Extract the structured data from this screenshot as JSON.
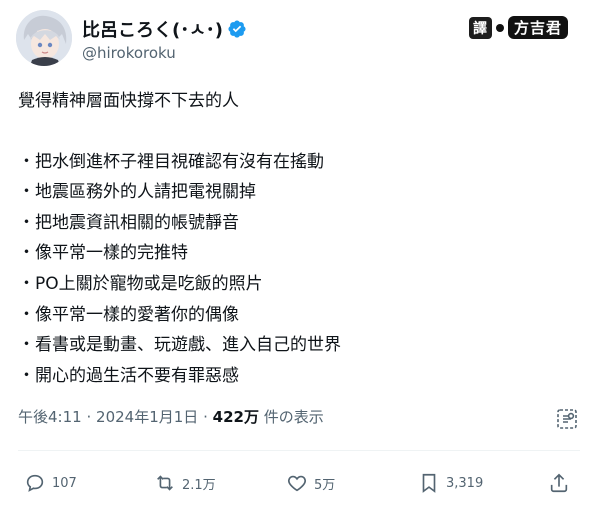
{
  "header": {
    "display_name": "比呂ころく(･ㅅ･)",
    "handle": "@hirokoroku"
  },
  "watermark": {
    "part1": "譯",
    "part2": "方吉君"
  },
  "tweet": {
    "lines": [
      "覺得精神層面快撐不下去的人",
      "・把水倒進杯子裡目視確認有沒有在搖動",
      "・地震區務外的人請把電視關掉",
      "・把地震資訊相關的帳號靜音",
      "・像平常一樣的完推特",
      "・PO上關於寵物或是吃飯的照片",
      "・像平常一樣的愛著你的偶像",
      "・看書或是動畫、玩遊戲、進入自己的世界",
      "・開心的過生活不要有罪惡感"
    ]
  },
  "meta": {
    "time": "午後4:11",
    "separator": "·",
    "date": "2024年1月1日",
    "views_count": "422万",
    "views_label": "件の表示"
  },
  "actions": {
    "replies": "107",
    "reposts": "2.1万",
    "likes": "5万",
    "bookmarks": "3,319"
  },
  "colors": {
    "text": "#0f1419",
    "secondary": "#536471",
    "verified": "#1d9bf0",
    "divider": "#eff3f4"
  }
}
